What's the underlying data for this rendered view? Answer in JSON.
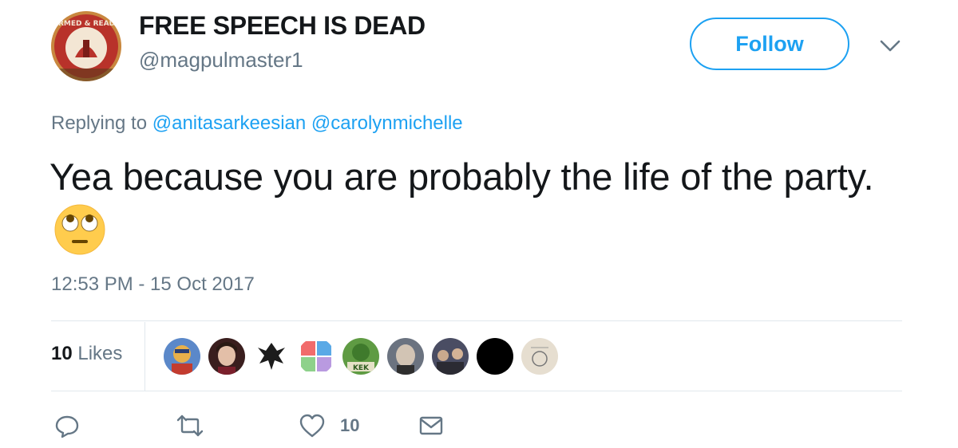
{
  "user": {
    "display_name": "FREE SPEECH IS DEAD",
    "handle": "@magpulmaster1",
    "avatar_text": "ARMED & READY",
    "avatar_icon": "armed-and-ready-logo"
  },
  "follow_label": "Follow",
  "replying": {
    "prefix": "Replying to",
    "mentions": [
      "@anitasarkeesian",
      "@carolynmichelle"
    ]
  },
  "tweet": {
    "text": "Yea because you are probably the life of the party.",
    "emoji": "face-with-rolling-eyes"
  },
  "timestamp": "12:53 PM - 15 Oct 2017",
  "likes": {
    "count": "10",
    "label": "Likes"
  },
  "actions": {
    "reply_icon": "reply-icon",
    "retweet_icon": "retweet-icon",
    "like_icon": "heart-icon",
    "like_count": "10",
    "message_icon": "envelope-icon"
  },
  "colors": {
    "accent": "#1da1f2",
    "secondary_text": "#657786",
    "divider": "#e1e8ed"
  }
}
